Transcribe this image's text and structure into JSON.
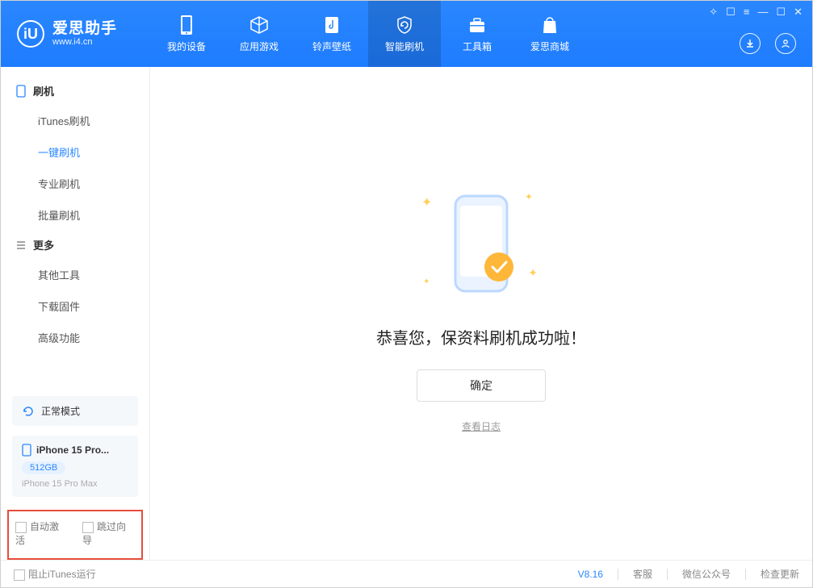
{
  "app": {
    "title": "爱思助手",
    "subtitle": "www.i4.cn"
  },
  "nav": {
    "items": [
      {
        "label": "我的设备"
      },
      {
        "label": "应用游戏"
      },
      {
        "label": "铃声壁纸"
      },
      {
        "label": "智能刷机"
      },
      {
        "label": "工具箱"
      },
      {
        "label": "爱思商城"
      }
    ]
  },
  "sidebar": {
    "section1_title": "刷机",
    "section1_items": [
      "iTunes刷机",
      "一键刷机",
      "专业刷机",
      "批量刷机"
    ],
    "section2_title": "更多",
    "section2_items": [
      "其他工具",
      "下载固件",
      "高级功能"
    ],
    "status_label": "正常模式",
    "device": {
      "name": "iPhone 15 Pro...",
      "badge": "512GB",
      "sub": "iPhone 15 Pro Max"
    },
    "auto_activate": "自动激活",
    "skip_wizard": "跳过向导"
  },
  "main": {
    "success_text": "恭喜您，保资料刷机成功啦！",
    "ok": "确定",
    "view_log": "查看日志"
  },
  "footer": {
    "block_itunes": "阻止iTunes运行",
    "version": "V8.16",
    "support": "客服",
    "wechat": "微信公众号",
    "update": "检查更新"
  }
}
